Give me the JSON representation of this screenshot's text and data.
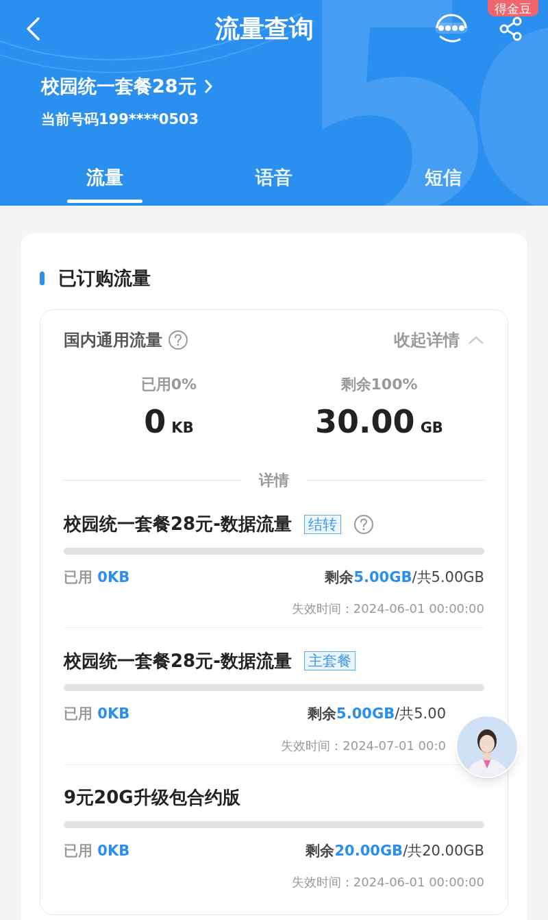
{
  "header": {
    "title": "流量查询",
    "badge": "得金豆",
    "plan": "校园统一套餐28元",
    "phone": "当前号码199****0503"
  },
  "tabs": [
    {
      "label": "流量",
      "selected": true
    },
    {
      "label": "语音",
      "selected": false
    },
    {
      "label": "短信",
      "selected": false
    }
  ],
  "section": {
    "title": "已订购流量",
    "summary": {
      "title": "国内通用流量",
      "toggle": "收起详情",
      "expanded": true,
      "used_label": "已用0%",
      "used_value": "0",
      "used_unit": "KB",
      "remaining_label": "剩余100%",
      "remaining_value": "30.00",
      "remaining_unit": "GB",
      "divider_label": "详情"
    },
    "items": [
      {
        "name": "校园统一套餐28元-数据流量",
        "tag": "结转",
        "help": true,
        "level": 0,
        "used_label": "已用",
        "used": "0KB",
        "remaining_label": "剩余",
        "remaining": "5.00GB",
        "total": "/共5.00GB",
        "expiry": "失效时间：2024-06-01 00:00:00",
        "obscured": false
      },
      {
        "name": "校园统一套餐28元-数据流量",
        "tag": "主套餐",
        "help": false,
        "level": 0,
        "used_label": "已用",
        "used": "0KB",
        "remaining_label": "剩余",
        "remaining": "5.00GB",
        "total": "/共5.00",
        "expiry": "失效时间：2024-07-01 00:0",
        "obscured": true
      },
      {
        "name": "9元20G升级包合约版",
        "level": 0,
        "help": false,
        "used_label": "已用",
        "used": "0KB",
        "remaining_label": "剩余",
        "remaining": "20.00GB",
        "total": "/共20.00GB",
        "expiry": "失效时间：2024-06-01 00:00:00",
        "obscured": false
      }
    ]
  }
}
